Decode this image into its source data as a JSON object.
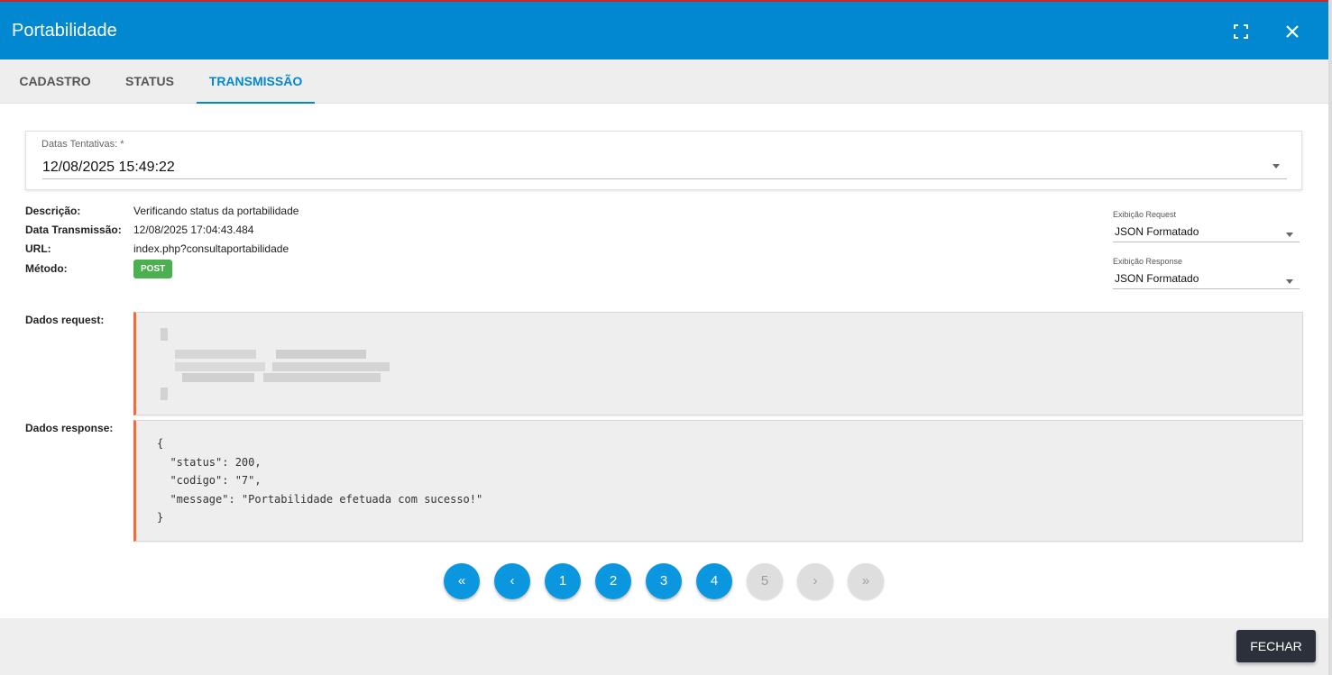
{
  "window": {
    "title": "Portabilidade"
  },
  "tabs": [
    {
      "label": "CADASTRO",
      "active": false
    },
    {
      "label": "STATUS",
      "active": false
    },
    {
      "label": "TRANSMISSÃO",
      "active": true
    }
  ],
  "attempts": {
    "label": "Datas Tentativas: *",
    "value": "12/08/2025 15:49:22"
  },
  "details": {
    "descricao_label": "Descrição:",
    "descricao": "Verificando status da portabilidade",
    "data_label": "Data Transmissão:",
    "data": "12/08/2025 17:04:43.484",
    "url_label": "URL:",
    "url": "index.php?consultaportabilidade",
    "metodo_label": "Método:",
    "metodo": "POST"
  },
  "request_view": {
    "label": "Exibição Request",
    "value": "JSON Formatado"
  },
  "response_view": {
    "label": "Exibição Response",
    "value": "JSON Formatado"
  },
  "request": {
    "label": "Dados request:",
    "redacted": true
  },
  "response": {
    "label": "Dados response:",
    "body": "{\n  \"status\": 200,\n  \"codigo\": \"7\",\n  \"message\": \"Portabilidade efetuada com sucesso!\"\n}"
  },
  "pagination": {
    "first": "«",
    "prev": "‹",
    "next": "›",
    "last": "»",
    "pages": [
      "1",
      "2",
      "3",
      "4",
      "5"
    ],
    "current": "5"
  },
  "footer": {
    "close_label": "FECHAR"
  },
  "colors": {
    "primary": "#0288d1",
    "badge": "#4caf50",
    "accent_border": "#ee6e3a",
    "button_dark": "#2b303a"
  },
  "icons": {
    "fullscreen": "fullscreen-icon",
    "close": "close-icon",
    "dropdown": "caret-down-icon"
  }
}
